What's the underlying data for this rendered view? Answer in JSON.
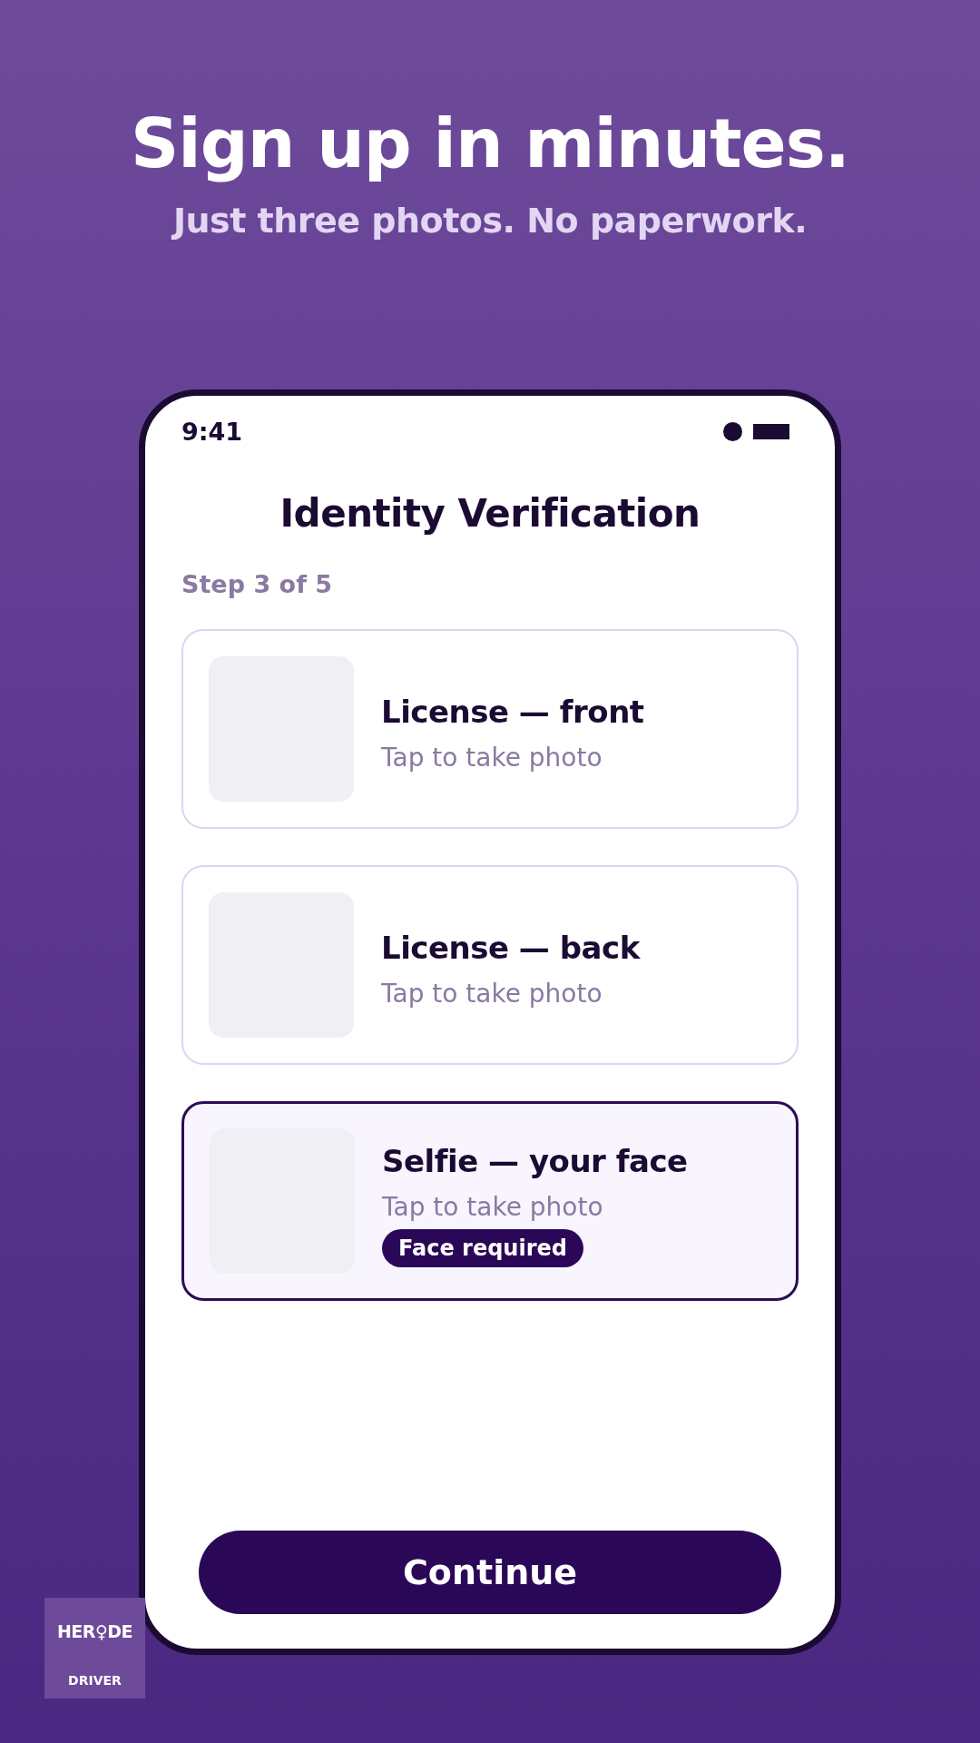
{
  "headline": "Sign up in minutes.",
  "subheadline": "Just three photos. No paperwork.",
  "phone": {
    "status_bar": {
      "time": "9:41"
    },
    "title": "Identity Verification",
    "step": "Step 3 of 5",
    "cards": [
      {
        "title": "License — front",
        "subtitle": "Tap to take photo",
        "selected": false
      },
      {
        "title": "License — back",
        "subtitle": "Tap to take photo",
        "selected": false
      },
      {
        "title": "Selfie — your face",
        "subtitle": "Tap to take photo",
        "selected": true,
        "badge": "Face required"
      }
    ],
    "button": "Continue"
  },
  "brand": {
    "logo": "HER♀DE",
    "caption": "DRIVER"
  }
}
